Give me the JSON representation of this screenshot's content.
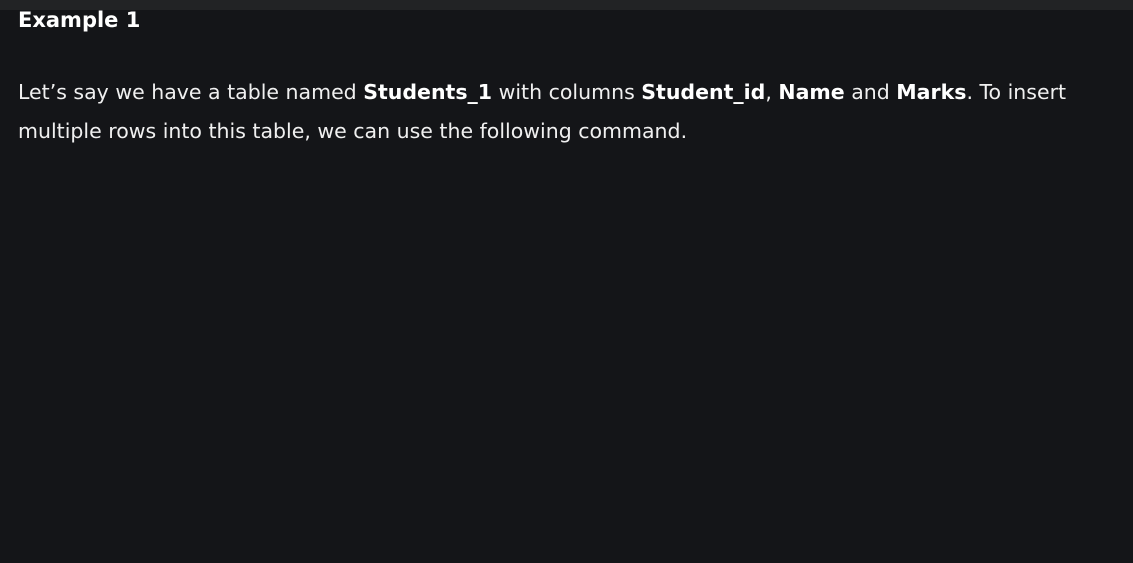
{
  "article": {
    "heading": "Example 1",
    "paragraph": {
      "text_1": "Let’s say we have a table named ",
      "table_name": "Students_1",
      "text_2": " with columns ",
      "column_1": "Student_id",
      "text_3": ", ",
      "column_2": "Name",
      "text_4": " and ",
      "column_3": "Marks",
      "text_5": ". To insert multiple rows into this table, we can use the following command."
    }
  },
  "colors": {
    "background": "#141518",
    "top_bar": "#222325",
    "text": "#f0f0f0"
  }
}
